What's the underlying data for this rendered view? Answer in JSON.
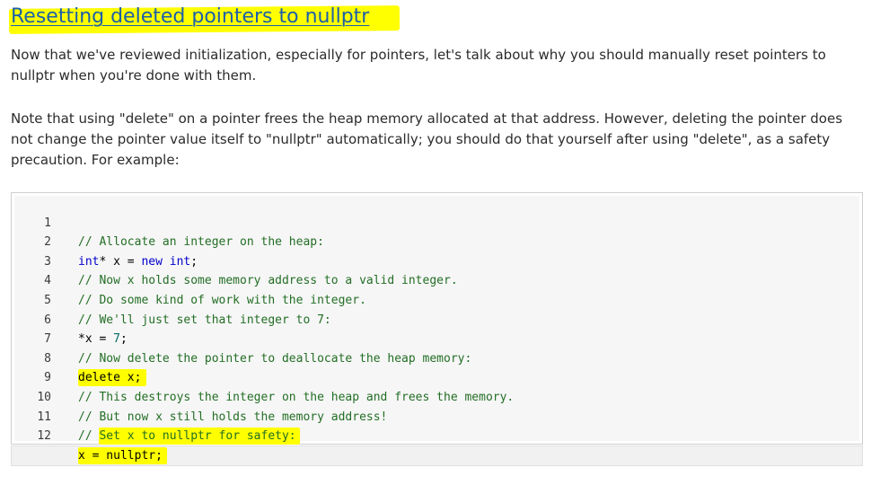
{
  "heading": {
    "title": "Resetting deleted pointers to nullptr"
  },
  "paragraphs": [
    "Now that we've reviewed initialization, especially for pointers, let's talk about why you should manually reset pointers to nullptr when you're done with them.",
    "Note that using \"delete\" on a pointer frees the heap memory allocated at that address. However, deleting the pointer does not change the pointer value itself to \"nullptr\" automatically; you should do that yourself after using \"delete\", as a safety precaution. For example:"
  ],
  "code": {
    "line_numbers": [
      "1",
      "2",
      "3",
      "4",
      "5",
      "6",
      "7",
      "8",
      "9",
      "10",
      "11",
      "12"
    ],
    "lines": [
      "// Allocate an integer on the heap:",
      "int* x = new int;",
      "// Now x holds some memory address to a valid integer.",
      "// Do some kind of work with the integer.",
      "// We'll just set that integer to 7:",
      "*x = 7;",
      "// Now delete the pointer to deallocate the heap memory:",
      "delete x;",
      "// This destroys the integer on the heap and frees the memory.",
      "// But now x still holds the memory address!",
      "// Set x to nullptr for safety:",
      "x = nullptr;"
    ],
    "tokens": {
      "l2_type": "int",
      "l2_mid": "* x = ",
      "l2_new": "new",
      "l2_sp": " ",
      "l2_int": "int",
      "l2_end": ";",
      "l6_pre": "*x = ",
      "l6_num": "7",
      "l6_end": ";",
      "l11_prefix": "// ",
      "l11_highlight": "Set x to nullptr for safety:"
    }
  },
  "colors": {
    "title": "#1b5fab",
    "highlight": "#ffff00",
    "comment": "#236e25",
    "keyword": "#0000cc",
    "number": "#096a6a",
    "text": "#2b2b2b"
  }
}
